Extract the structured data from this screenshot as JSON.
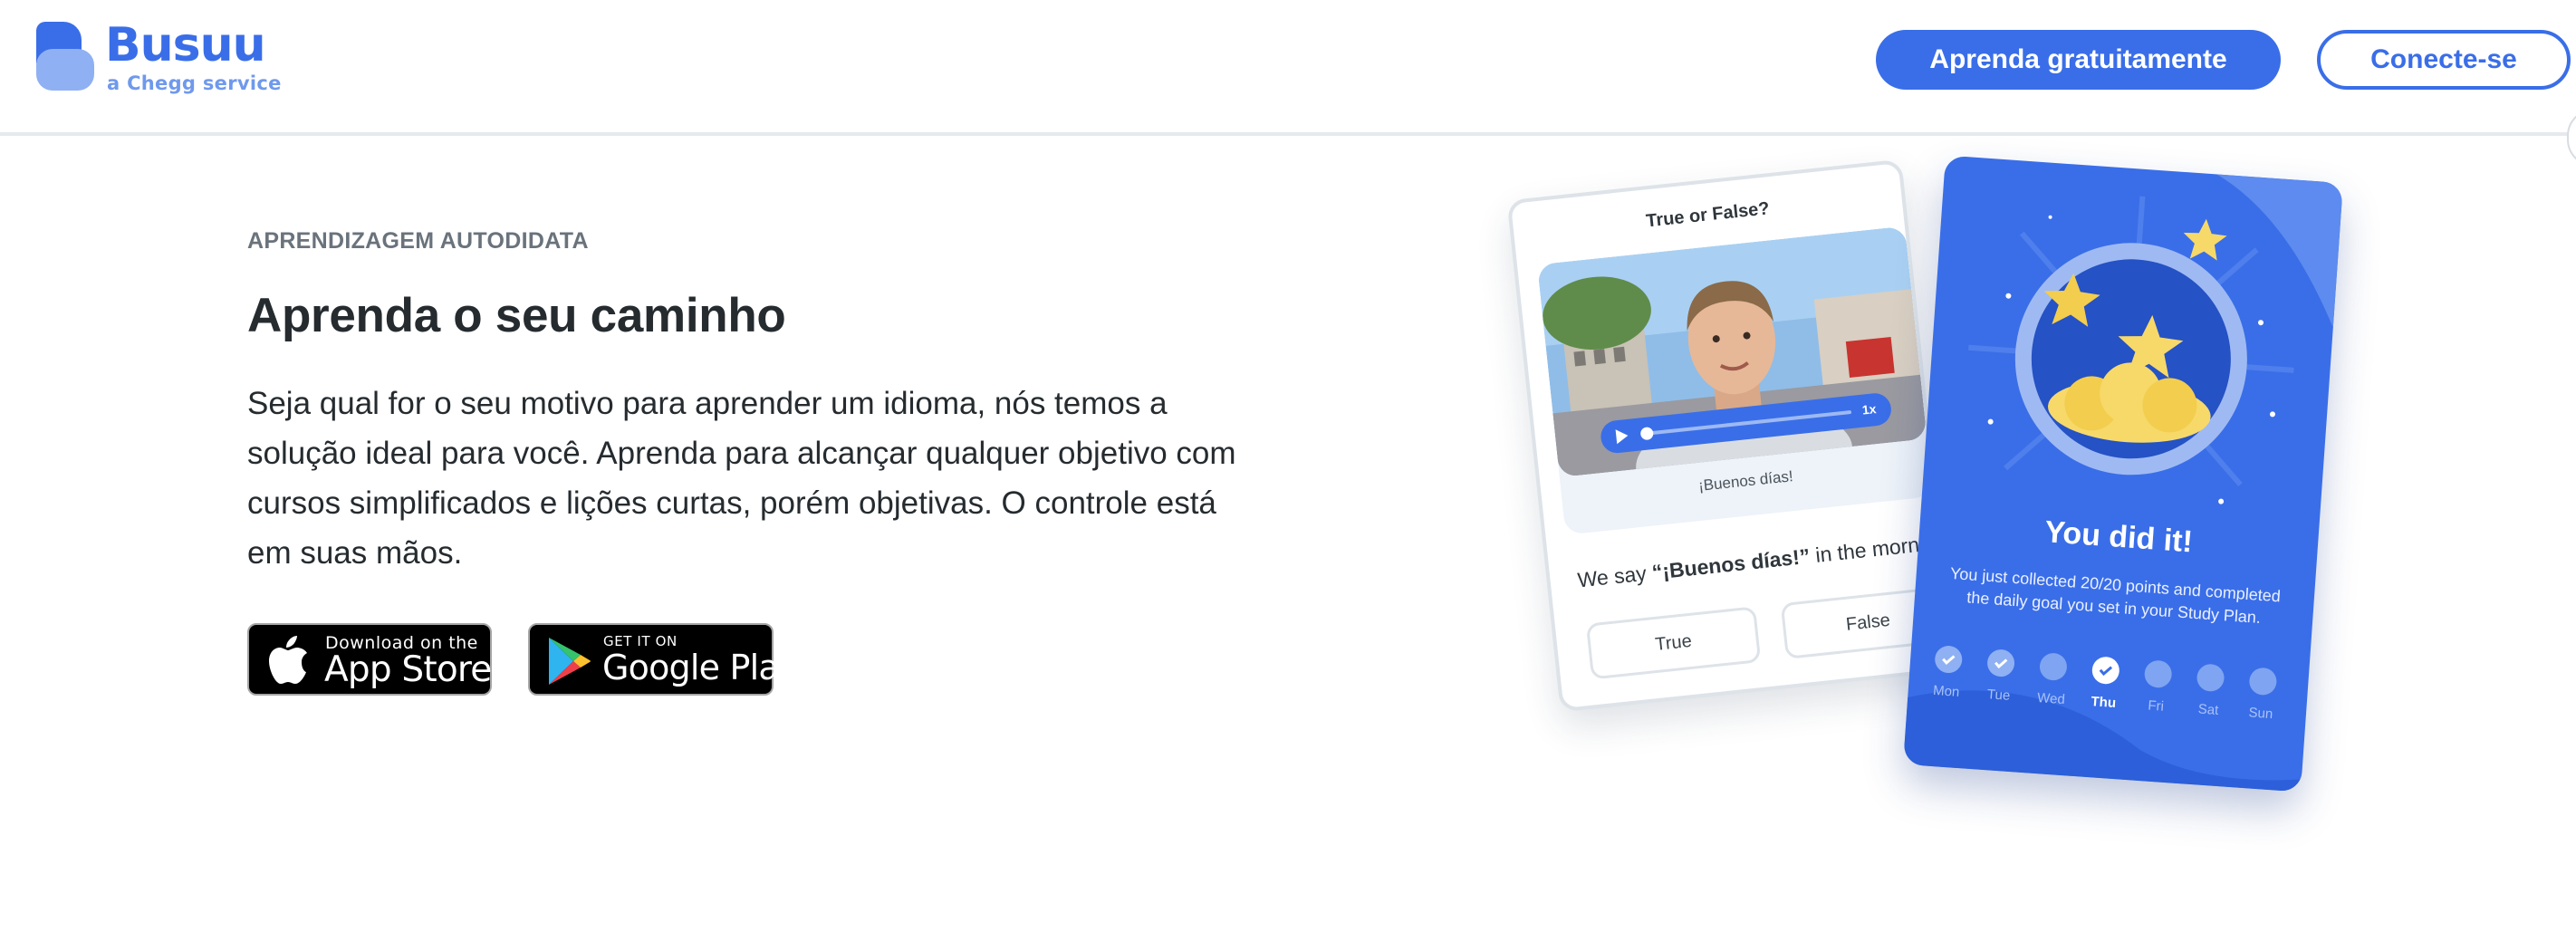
{
  "header": {
    "logo_name": "Busuu",
    "logo_tagline": "a Chegg service",
    "cta_primary": "Aprenda gratuitamente",
    "cta_secondary": "Conecte-se"
  },
  "hero": {
    "eyebrow": "APRENDIZAGEM AUTODIDATA",
    "title": "Aprenda o seu caminho",
    "body": "Seja qual for o seu motivo para aprender um idioma, nós temos a solução ideal para você. Aprenda para alcançar qualquer objetivo com cursos simplificados e lições curtas, porém objetivas. O controle está em suas mãos."
  },
  "stores": {
    "apple": {
      "small": "Download on the",
      "big": "App Store",
      "icon": "apple-icon"
    },
    "google": {
      "small": "GET IT ON",
      "big": "Google Play",
      "icon": "google-play-icon"
    }
  },
  "quiz_card": {
    "title": "True or False?",
    "speed": "1x",
    "caption": "¡Buenos días!",
    "sentence_before": "We say ",
    "sentence_bold": "“¡Buenos días!”",
    "sentence_after": " in the mornin",
    "option_true": "True",
    "option_false": "False"
  },
  "goal_card": {
    "title": "You did it!",
    "text": "You just collected 20/20 points and completed the daily goal you set in your Study Plan.",
    "days": [
      {
        "label": "Mon",
        "state": "done"
      },
      {
        "label": "Tue",
        "state": "done"
      },
      {
        "label": "Wed",
        "state": "pending"
      },
      {
        "label": "Thu",
        "state": "today"
      },
      {
        "label": "Fri",
        "state": "pending"
      },
      {
        "label": "Sat",
        "state": "pending"
      },
      {
        "label": "Sun",
        "state": "pending"
      }
    ]
  },
  "colors": {
    "brand_blue": "#3a6ee8",
    "brand_light": "#8fb0f3",
    "text_dark": "#252b2f",
    "eyebrow_gray": "#6a737c"
  }
}
